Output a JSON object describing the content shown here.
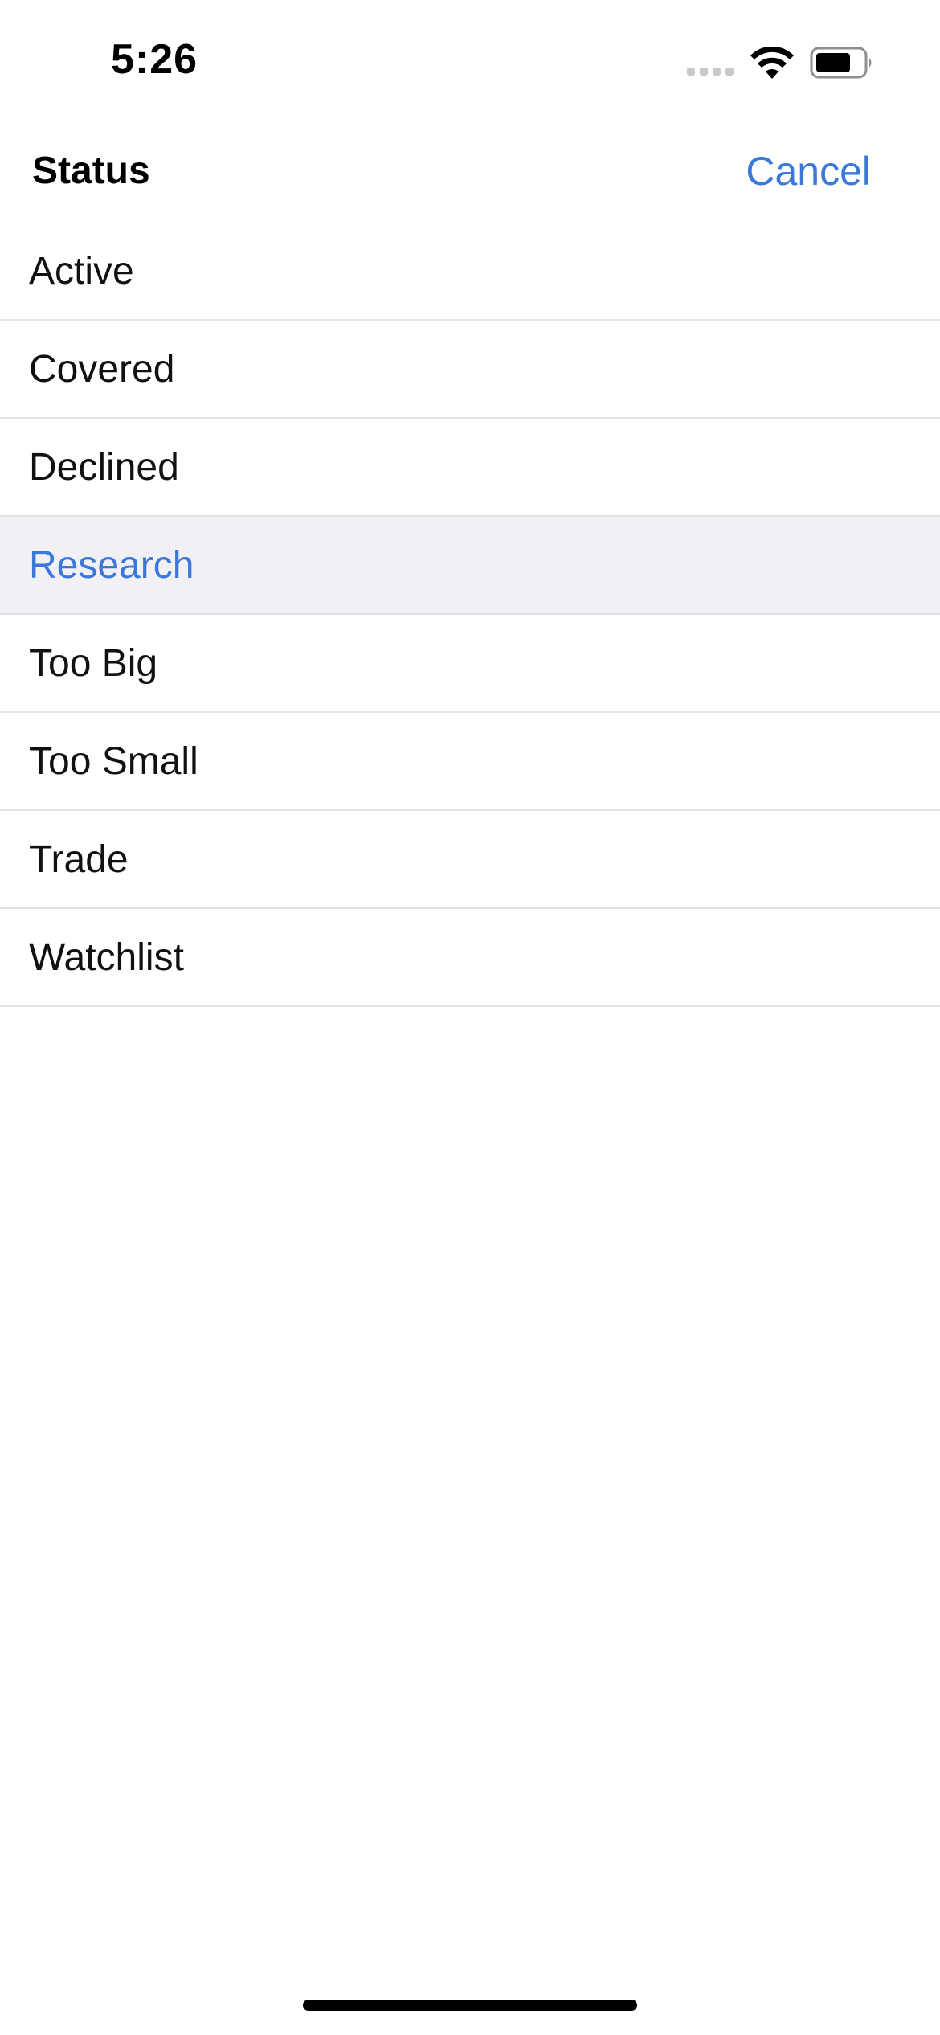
{
  "status_bar": {
    "time": "5:26",
    "icons": [
      "cellular-signal-icon",
      "wifi-icon",
      "battery-icon"
    ]
  },
  "header": {
    "title": "Status",
    "cancel_label": "Cancel"
  },
  "list": {
    "items": [
      {
        "label": "Active",
        "selected": false
      },
      {
        "label": "Covered",
        "selected": false
      },
      {
        "label": "Declined",
        "selected": false
      },
      {
        "label": "Research",
        "selected": true
      },
      {
        "label": "Too Big",
        "selected": false
      },
      {
        "label": "Too Small",
        "selected": false
      },
      {
        "label": "Trade",
        "selected": false
      },
      {
        "label": "Watchlist",
        "selected": false
      }
    ]
  },
  "colors": {
    "accent": "#3b78d8",
    "selected_background": "#f1f1f5",
    "divider": "#e3e3e6",
    "text": "#111111"
  }
}
